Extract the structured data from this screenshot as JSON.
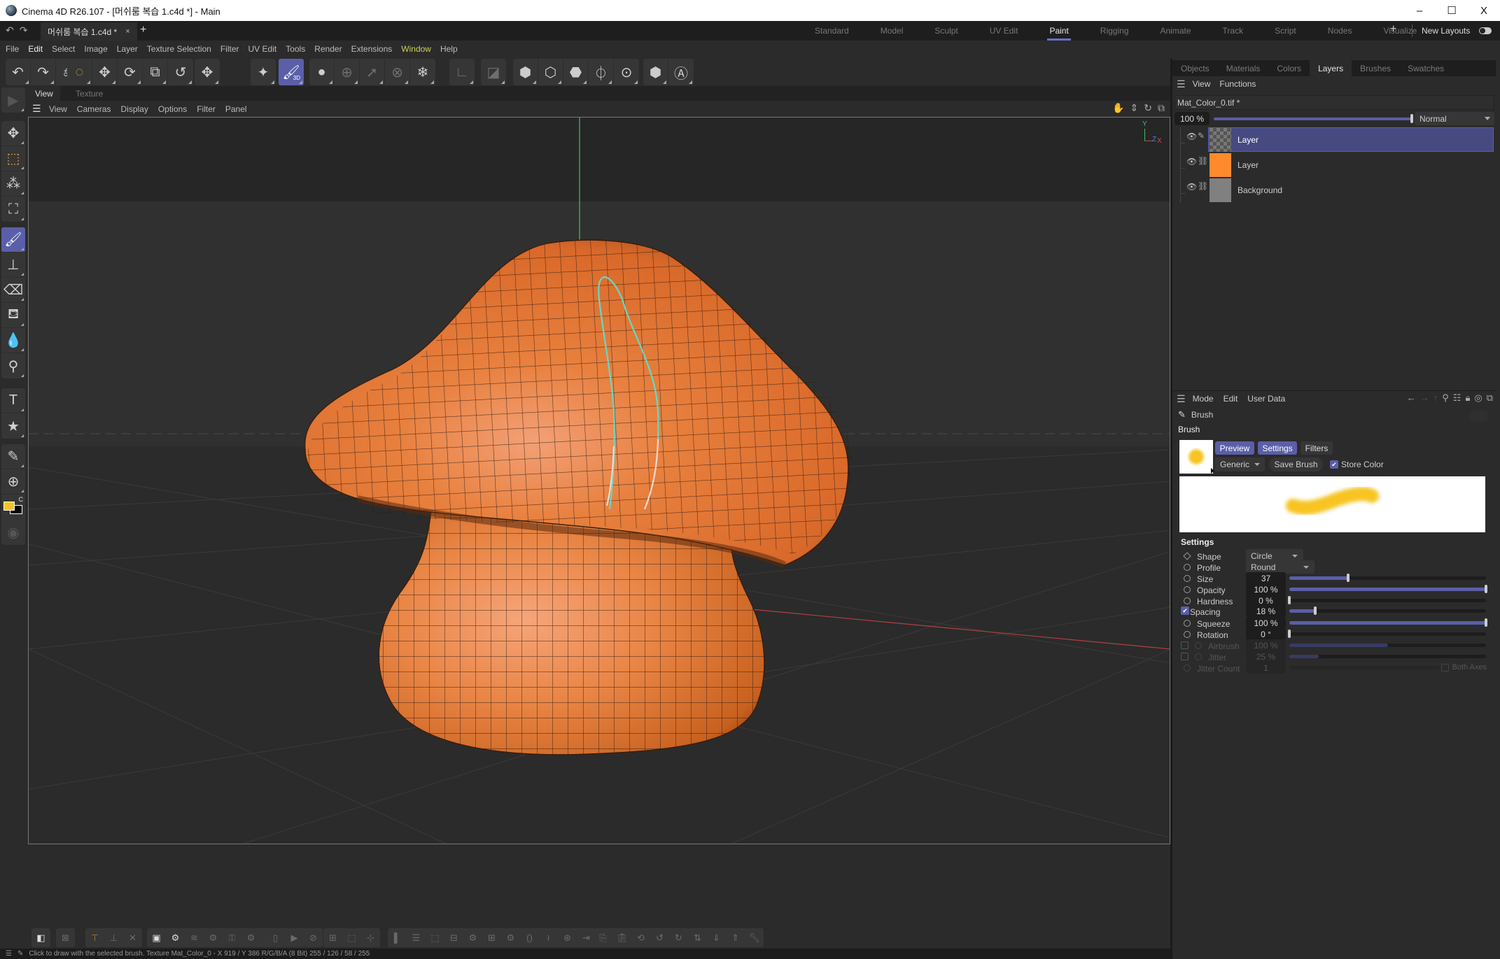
{
  "window": {
    "title": "Cinema 4D R26.107 - [머쉬룸 복습 1.c4d *] - Main",
    "controls": {
      "minimize": "–",
      "maximize": "☐",
      "close": "X"
    }
  },
  "document_tab": {
    "label": "머쉬룸 복습 1.c4d *",
    "close": "×",
    "new": "+"
  },
  "layouts": {
    "items": [
      "Standard",
      "Model",
      "Sculpt",
      "UV Edit",
      "Paint",
      "Rigging",
      "Animate",
      "Track",
      "Script",
      "Nodes",
      "Visualize"
    ],
    "active": "Paint",
    "add": "+",
    "new_layouts": "New Layouts"
  },
  "menu": [
    "File",
    "Edit",
    "Select",
    "Image",
    "Layer",
    "Texture Selection",
    "Filter",
    "UV Edit",
    "Tools",
    "Render",
    "Extensions",
    "Window",
    "Help"
  ],
  "toolbar": {
    "groups": [
      [
        {
          "icon": "undo-icon",
          "glyph": "↶"
        },
        {
          "icon": "redo-icon",
          "glyph": "↷"
        },
        {
          "icon": "revert-icon",
          "glyph": "⎌"
        }
      ],
      [
        {
          "icon": "live-selection-icon",
          "glyph": "◌",
          "style": "orange"
        },
        {
          "icon": "move-icon",
          "glyph": "✥"
        },
        {
          "icon": "rotate-icon",
          "glyph": "⟳"
        },
        {
          "icon": "scale-icon",
          "glyph": "⧉"
        },
        {
          "icon": "transfer-icon",
          "glyph": "↺"
        }
      ],
      [
        {
          "icon": "axis-move-icon",
          "glyph": "✥"
        }
      ],
      [
        {
          "icon": "sparkle-icon",
          "glyph": "✦"
        }
      ],
      [
        {
          "icon": "paint-3d-icon",
          "glyph": "🖌",
          "style": "active",
          "sub": "3D"
        }
      ],
      [
        {
          "icon": "brush-circle-icon",
          "glyph": "●"
        },
        {
          "icon": "pin-icon",
          "glyph": "⊕",
          "style": "dim"
        },
        {
          "icon": "arrow-circle-icon",
          "glyph": "➚",
          "style": "dim"
        },
        {
          "icon": "cross-circle-icon",
          "glyph": "⊗",
          "style": "dim"
        },
        {
          "icon": "snowflake-icon",
          "glyph": "❄"
        }
      ],
      [
        {
          "icon": "axis-icon",
          "glyph": "∟",
          "style": "dim"
        }
      ],
      [
        {
          "icon": "texture-mode-icon",
          "glyph": "◪",
          "style": "dim"
        }
      ],
      [
        {
          "icon": "cube-solid-icon",
          "glyph": "⬢"
        },
        {
          "icon": "cube-outline-icon",
          "glyph": "⬡"
        },
        {
          "icon": "cube-half-icon",
          "glyph": "⬣"
        },
        {
          "icon": "cube-line-icon",
          "glyph": "⏀"
        },
        {
          "icon": "cube-dot-icon",
          "glyph": "⊙"
        }
      ],
      [
        {
          "icon": "hex-eye-icon",
          "glyph": "⬢"
        },
        {
          "icon": "hex-a-icon",
          "glyph": "Ⓐ"
        }
      ]
    ]
  },
  "left_tools": [
    [
      {
        "icon": "play-arrow-icon",
        "glyph": "▶",
        "style": "dim"
      }
    ],
    [
      {
        "icon": "move-tool-icon",
        "glyph": "✥"
      },
      {
        "icon": "rect-selection-icon",
        "glyph": "⬚",
        "style": "orange"
      },
      {
        "icon": "magic-wand-icon",
        "glyph": "⁂"
      },
      {
        "icon": "transform-box-icon",
        "glyph": "⛶"
      }
    ],
    [
      {
        "icon": "paint-brush-icon",
        "glyph": "🖌",
        "style": "active"
      },
      {
        "icon": "stamp-icon",
        "glyph": "⊥"
      },
      {
        "icon": "eraser-icon",
        "glyph": "⌫"
      },
      {
        "icon": "fill-bucket-icon",
        "glyph": "⛾"
      },
      {
        "icon": "blur-drop-icon",
        "glyph": "💧"
      },
      {
        "icon": "smudge-icon",
        "glyph": "⚲"
      }
    ],
    [
      {
        "icon": "text-tool-icon",
        "glyph": "T"
      },
      {
        "icon": "star-shape-icon",
        "glyph": "★"
      }
    ],
    [
      {
        "icon": "eyedropper-icon",
        "glyph": "✎"
      },
      {
        "icon": "zoom-tool-icon",
        "glyph": "⊕"
      }
    ]
  ],
  "colors": {
    "foreground": "#f6c428",
    "background": "#000000",
    "swap_label": "C",
    "accent": "#5a5fa8",
    "mesh": "#e57a2e"
  },
  "viewport": {
    "tabs": [
      {
        "label": "View",
        "active": true
      },
      {
        "label": "Texture",
        "active": false
      }
    ],
    "menu": [
      "View",
      "Cameras",
      "Display",
      "Options",
      "Filter",
      "Panel"
    ],
    "nav_icons": [
      "hand-pan-icon",
      "dolly-icon",
      "orbit-icon",
      "maximize-view-icon"
    ],
    "axis": {
      "y": "Y",
      "z": "Z",
      "x": "X"
    }
  },
  "status": {
    "text": "Click to draw with the selected brush. Texture Mat_Color_0 - X 919 / Y 386 R/G/B/A (8 Bit) 255 / 126 / 58 / 255"
  },
  "right_panel": {
    "tabs": [
      "Objects",
      "Materials",
      "Colors",
      "Layers",
      "Brushes",
      "Swatches"
    ],
    "active_tab": "Layers",
    "menu": [
      "View",
      "Functions"
    ],
    "file": "Mat_Color_0.tif *",
    "opacity": "100 %",
    "opacity_fraction": 1.0,
    "blend_mode": "Normal",
    "layers": [
      {
        "name": "Layer",
        "thumb": "checker",
        "selected": true,
        "edit_icon": "pencil-icon"
      },
      {
        "name": "Layer",
        "thumb": "#ff8a2e",
        "selected": false,
        "edit_icon": "link-icon"
      },
      {
        "name": "Background",
        "thumb": "#808080",
        "selected": false,
        "edit_icon": "link-icon"
      }
    ]
  },
  "attributes": {
    "menu": [
      "Mode",
      "Edit",
      "User Data"
    ],
    "object": "Brush",
    "section": "Brush",
    "buttons": {
      "preview": "Preview",
      "settings": "Settings",
      "filters": "Filters"
    },
    "preset": "Generic",
    "save_brush": "Save Brush",
    "store_color": {
      "label": "Store Color",
      "checked": true
    },
    "settings_title": "Settings",
    "params": [
      {
        "label": "Shape",
        "type": "select",
        "value": "Circle",
        "anim": "diamond"
      },
      {
        "label": "Profile",
        "type": "select",
        "value": "Round"
      },
      {
        "label": "Size",
        "type": "slider",
        "value": "37",
        "fraction": 0.3
      },
      {
        "label": "Opacity",
        "type": "slider",
        "value": "100 %",
        "fraction": 1.0
      },
      {
        "label": "Hardness",
        "type": "slider",
        "value": "0 %",
        "fraction": 0.0
      },
      {
        "label": "Spacing",
        "type": "slider",
        "value": "18 %",
        "fraction": 0.13,
        "checkbox": true
      },
      {
        "label": "Squeeze",
        "type": "slider",
        "value": "100 %",
        "fraction": 1.0
      },
      {
        "label": "Rotation",
        "type": "slider",
        "value": "0 °",
        "fraction": 0.0
      },
      {
        "label": "Airbrush",
        "type": "slider",
        "value": "100 %",
        "fraction": 0.5,
        "disabled": true,
        "checkbox_off": true
      },
      {
        "label": "Jitter",
        "type": "slider",
        "value": "25 %",
        "fraction": 0.15,
        "disabled": true,
        "checkbox_off": true
      },
      {
        "label": "Jitter Count",
        "type": "value",
        "value": "1",
        "disabled": true
      }
    ],
    "both_axes": "Both Axes"
  }
}
